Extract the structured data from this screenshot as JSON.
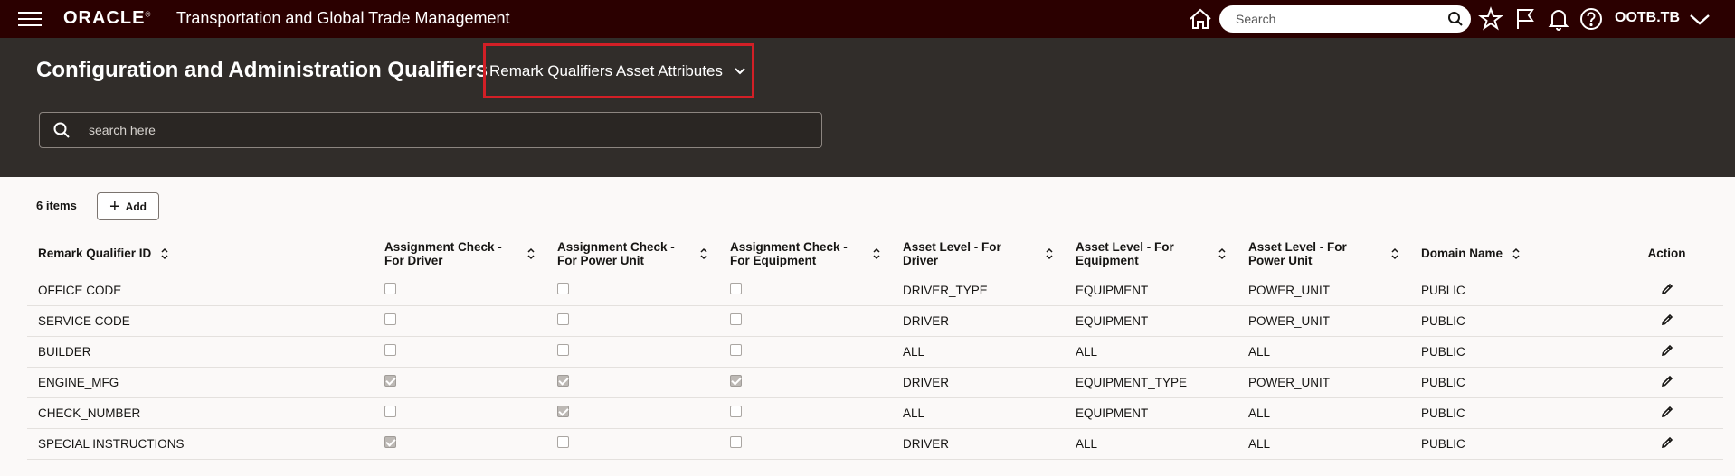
{
  "topbar": {
    "brand": "ORACLE",
    "brand_sup": "®",
    "app_title": "Transportation and Global Trade Management",
    "search_placeholder": "Search",
    "user": "OOTB.TB"
  },
  "header": {
    "title": "Configuration and Administration Qualifiers",
    "selector_label": "Remark Qualifiers Asset Attributes",
    "search_placeholder": "search here"
  },
  "toolbar": {
    "count": "6 items",
    "add_label": "Add"
  },
  "table": {
    "columns": [
      [
        "Remark Qualifier ID"
      ],
      [
        "Assignment Check -",
        "For Driver"
      ],
      [
        "Assignment Check -",
        "For Power Unit"
      ],
      [
        "Assignment Check -",
        "For Equipment"
      ],
      [
        "Asset Level - For",
        "Driver"
      ],
      [
        "Asset Level - For",
        "Equipment"
      ],
      [
        "Asset Level - For",
        "Power Unit"
      ],
      [
        "Domain Name"
      ],
      [
        "Action"
      ]
    ],
    "rows": [
      {
        "id": "OFFICE CODE",
        "chk_driver": false,
        "chk_power": false,
        "chk_equip": false,
        "lvl_driver": "DRIVER_TYPE",
        "lvl_equip": "EQUIPMENT",
        "lvl_power": "POWER_UNIT",
        "domain": "PUBLIC"
      },
      {
        "id": "SERVICE CODE",
        "chk_driver": false,
        "chk_power": false,
        "chk_equip": false,
        "lvl_driver": "DRIVER",
        "lvl_equip": "EQUIPMENT",
        "lvl_power": "POWER_UNIT",
        "domain": "PUBLIC"
      },
      {
        "id": "BUILDER",
        "chk_driver": false,
        "chk_power": false,
        "chk_equip": false,
        "lvl_driver": "ALL",
        "lvl_equip": "ALL",
        "lvl_power": "ALL",
        "domain": "PUBLIC"
      },
      {
        "id": "ENGINE_MFG",
        "chk_driver": true,
        "chk_power": true,
        "chk_equip": true,
        "lvl_driver": "DRIVER",
        "lvl_equip": "EQUIPMENT_TYPE",
        "lvl_power": "POWER_UNIT",
        "domain": "PUBLIC"
      },
      {
        "id": "CHECK_NUMBER",
        "chk_driver": false,
        "chk_power": true,
        "chk_equip": false,
        "lvl_driver": "ALL",
        "lvl_equip": "EQUIPMENT",
        "lvl_power": "ALL",
        "domain": "PUBLIC"
      },
      {
        "id": "SPECIAL INSTRUCTIONS",
        "chk_driver": true,
        "chk_power": false,
        "chk_equip": false,
        "lvl_driver": "DRIVER",
        "lvl_equip": "ALL",
        "lvl_power": "ALL",
        "domain": "PUBLIC"
      }
    ]
  },
  "colors": {
    "topbar_bg": "#2b0000",
    "header_bg": "#312d2a",
    "highlight": "#d21f26"
  },
  "icons": [
    "hamburger-icon",
    "home-icon",
    "search-icon",
    "star-icon",
    "flag-icon",
    "bell-icon",
    "help-icon",
    "chevron-down-icon",
    "sort-icon",
    "plus-icon",
    "edit-icon"
  ]
}
